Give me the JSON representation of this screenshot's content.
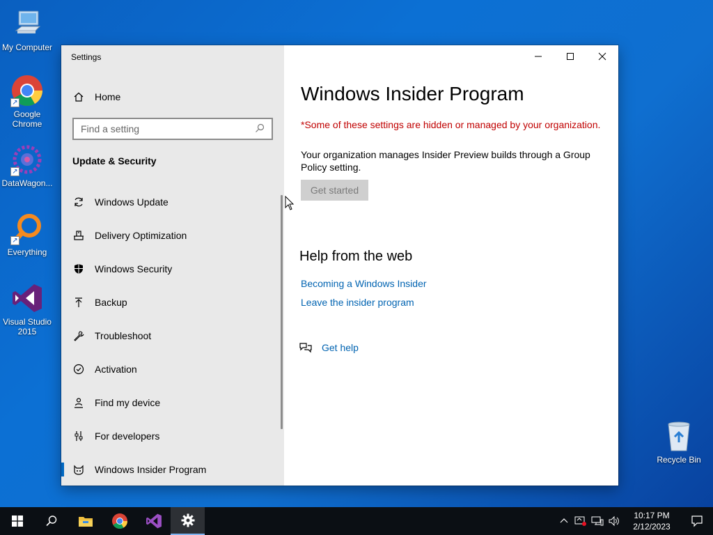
{
  "desktop": {
    "icons": [
      {
        "label": "My Computer"
      },
      {
        "label": "Google Chrome"
      },
      {
        "label": "DataWagon..."
      },
      {
        "label": "Everything"
      },
      {
        "label": "Visual Studio 2015"
      },
      {
        "label": "Recycle Bin"
      }
    ]
  },
  "window": {
    "title": "Settings",
    "sidebar": {
      "home_label": "Home",
      "search_placeholder": "Find a setting",
      "section_title": "Update & Security",
      "items": [
        {
          "label": "Windows Update",
          "icon": "refresh-icon"
        },
        {
          "label": "Delivery Optimization",
          "icon": "delivery-icon"
        },
        {
          "label": "Windows Security",
          "icon": "shield-icon"
        },
        {
          "label": "Backup",
          "icon": "backup-icon"
        },
        {
          "label": "Troubleshoot",
          "icon": "wrench-icon"
        },
        {
          "label": "Activation",
          "icon": "check-circle-icon"
        },
        {
          "label": "Find my device",
          "icon": "person-pin-icon"
        },
        {
          "label": "For developers",
          "icon": "developer-icon"
        },
        {
          "label": "Windows Insider Program",
          "icon": "insider-cat-icon",
          "active": true
        }
      ]
    },
    "main": {
      "title": "Windows Insider Program",
      "managed_notice": "*Some of these settings are hidden or managed by your organization.",
      "description": "Your organization manages Insider Preview builds through a Group Policy setting.",
      "get_started_label": "Get started",
      "help_title": "Help from the web",
      "links": [
        "Becoming a Windows Insider",
        "Leave the insider program"
      ],
      "get_help_label": "Get help"
    }
  },
  "taskbar": {
    "time": "10:17 PM",
    "date": "2/12/2023"
  },
  "colors": {
    "accent": "#0067c0",
    "link": "#0063b1",
    "warning": "#c00000",
    "sidebar_bg": "#e9e9e9",
    "taskbar_bg": "#0b0f14"
  }
}
